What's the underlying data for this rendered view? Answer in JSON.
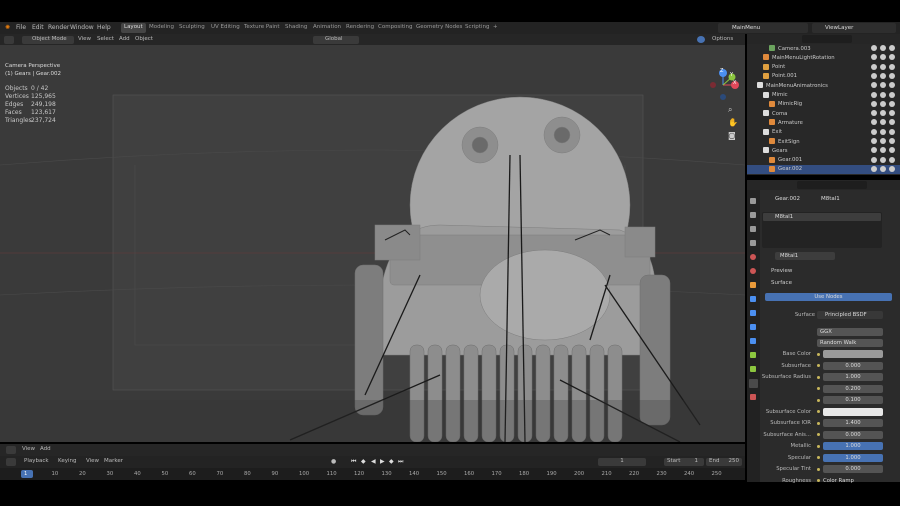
{
  "topbar": {
    "menus": [
      "File",
      "Edit",
      "Render",
      "Window",
      "Help"
    ],
    "workspaces": [
      "Layout",
      "Modeling",
      "Sculpting",
      "UV Editing",
      "Texture Paint",
      "Shading",
      "Animation",
      "Rendering",
      "Compositing",
      "Geometry Nodes",
      "Scripting"
    ],
    "scene": "MainMenu",
    "view_layer": "ViewLayer",
    "plus": "+"
  },
  "header": {
    "mode": "Object Mode",
    "view": "View",
    "select": "Select",
    "add": "Add",
    "object": "Object",
    "orientation": "Global",
    "options": "Options"
  },
  "viewport": {
    "camera_label": "Camera Perspective",
    "collection_label": "(1) Gears | Gear.002",
    "stats": [
      {
        "k": "Objects",
        "v": "0 / 42"
      },
      {
        "k": "Vertices",
        "v": "125,965"
      },
      {
        "k": "Edges",
        "v": "249,198"
      },
      {
        "k": "Faces",
        "v": "123,617"
      },
      {
        "k": "Triangles",
        "v": "237,724"
      }
    ],
    "gizmo": {
      "x": "X",
      "y": "Y",
      "z": "Z"
    }
  },
  "outliner": {
    "rows": [
      {
        "label": "Camera.003",
        "indent": 3,
        "color": "#6ba35e"
      },
      {
        "label": "MainMenuLightRotation",
        "indent": 2,
        "color": "#e08a3c"
      },
      {
        "label": "Point",
        "indent": 2,
        "color": "#e0a040"
      },
      {
        "label": "Point.001",
        "indent": 2,
        "color": "#e0a040"
      },
      {
        "label": "MainMenuAnimatronics",
        "indent": 1,
        "color": "#ddd"
      },
      {
        "label": "Mimic",
        "indent": 2,
        "color": "#ddd"
      },
      {
        "label": "MimicRig",
        "indent": 3,
        "color": "#e08a3c"
      },
      {
        "label": "Coma",
        "indent": 2,
        "color": "#ddd"
      },
      {
        "label": "Armature",
        "indent": 3,
        "color": "#e08a3c"
      },
      {
        "label": "Exit",
        "indent": 2,
        "color": "#ddd"
      },
      {
        "label": "ExitSign",
        "indent": 3,
        "color": "#e08a3c"
      },
      {
        "label": "Gears",
        "indent": 2,
        "color": "#ddd"
      },
      {
        "label": "Gear.001",
        "indent": 3,
        "color": "#e08a3c"
      },
      {
        "label": "Gear.002",
        "indent": 3,
        "color": "#e08a3c"
      }
    ]
  },
  "properties": {
    "object": "Gear.002",
    "material_slot": "M8tal1",
    "material_name": "M8tal1",
    "material_list_item": "M8tal1",
    "preview": "Preview",
    "surface": "Surface",
    "use_nodes": "Use Nodes",
    "surface_shader": "Principled BSDF",
    "distribution": "GGX",
    "subsurface_method": "Random Walk",
    "fields": [
      {
        "label": "Base Color",
        "value": "",
        "type": "color",
        "color": "#9a9a9a"
      },
      {
        "label": "Subsurface",
        "value": "0.000",
        "type": "num"
      },
      {
        "label": "Subsurface Radius",
        "value": "1.000",
        "type": "num"
      },
      {
        "label": "",
        "value": "0.200",
        "type": "num"
      },
      {
        "label": "",
        "value": "0.100",
        "type": "num"
      },
      {
        "label": "Subsurface Color",
        "value": "",
        "type": "color",
        "color": "#e8e8e8"
      },
      {
        "label": "Subsurface IOR",
        "value": "1.400",
        "type": "num"
      },
      {
        "label": "Subsurface Anis...",
        "value": "0.000",
        "type": "num"
      },
      {
        "label": "Metallic",
        "value": "1.000",
        "type": "blue"
      },
      {
        "label": "Specular",
        "value": "1.000",
        "type": "blue"
      },
      {
        "label": "Specular Tint",
        "value": "0.000",
        "type": "num"
      },
      {
        "label": "Roughness",
        "value": "Color Ramp",
        "type": "link"
      }
    ]
  },
  "timeline": {
    "view": "View",
    "add": "Add",
    "playback": "Playback",
    "keying": "Keying",
    "view2": "View",
    "marker": "Marker",
    "current_frame": "1",
    "start_label": "Start",
    "start": "1",
    "end_label": "End",
    "end": "250",
    "ticks": [
      "1",
      "10",
      "20",
      "30",
      "40",
      "50",
      "60",
      "70",
      "80",
      "90",
      "100",
      "110",
      "120",
      "130",
      "140",
      "150",
      "160",
      "170",
      "180",
      "190",
      "200",
      "210",
      "220",
      "230",
      "240",
      "250"
    ]
  }
}
